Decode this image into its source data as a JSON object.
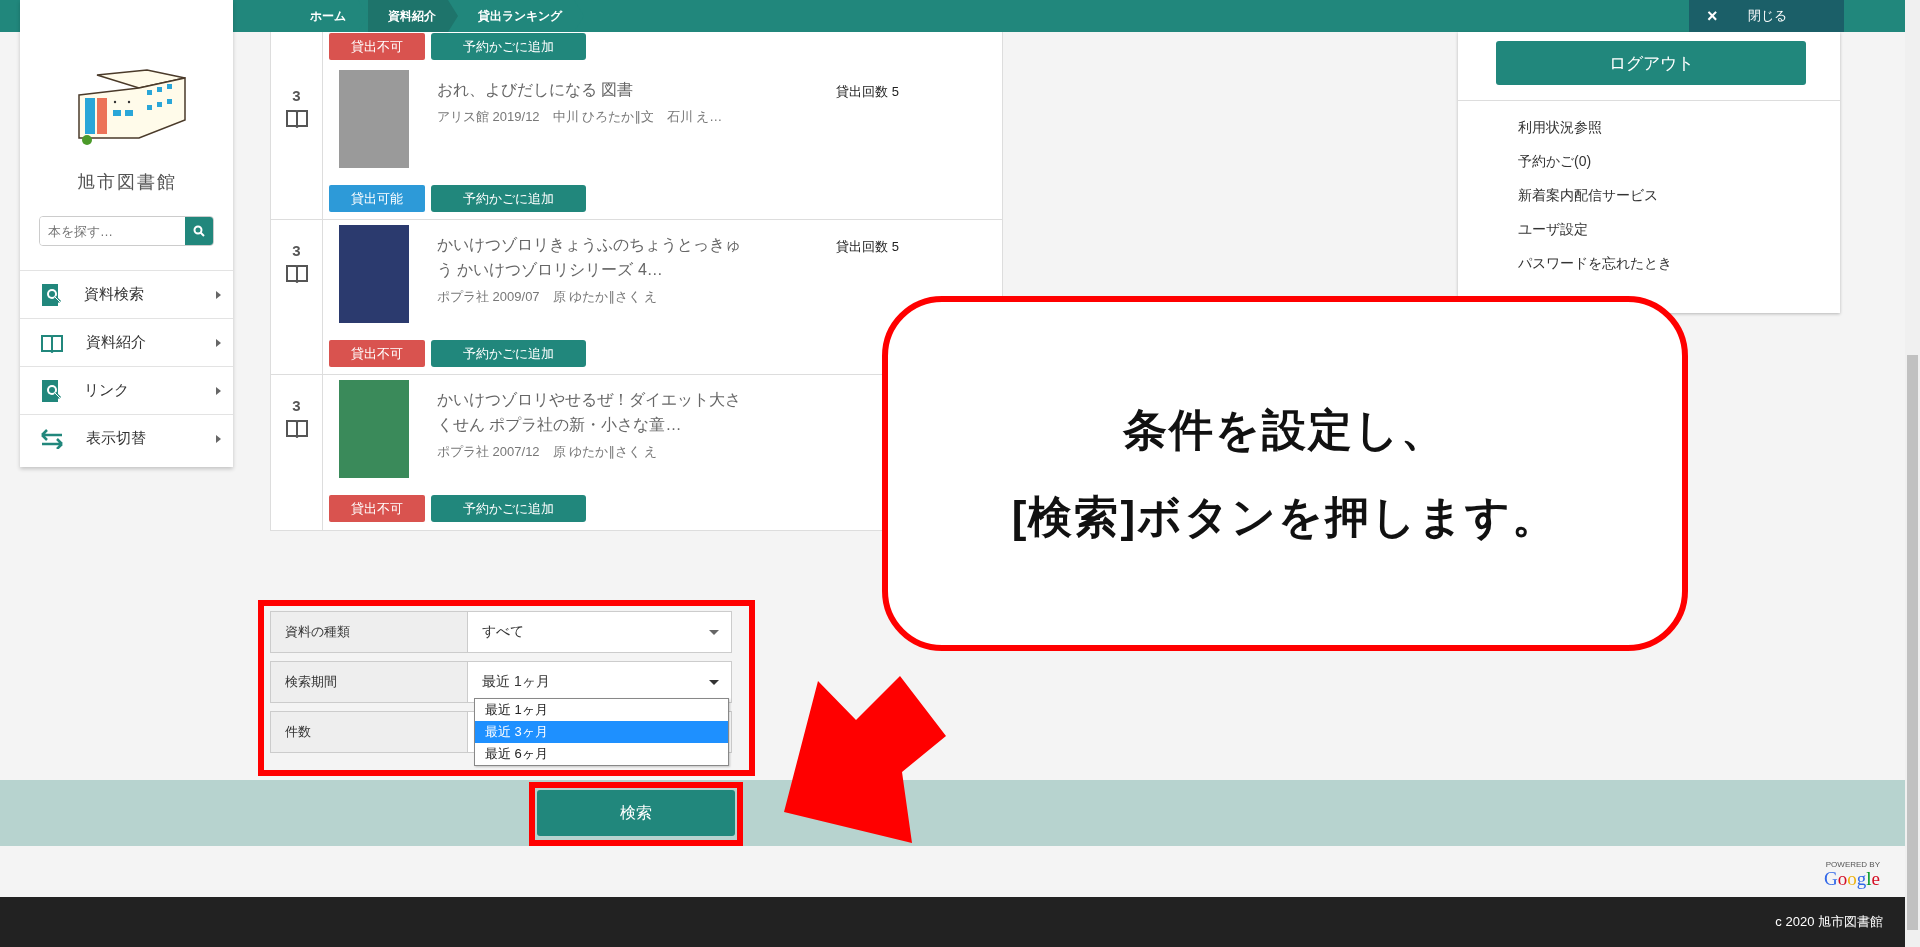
{
  "header": {
    "breadcrumbs": [
      {
        "label": "ホーム",
        "selected": false
      },
      {
        "label": "資料紹介",
        "selected": true
      },
      {
        "label": "貸出ランキング",
        "selected": false
      }
    ],
    "close_button": {
      "icon": "×",
      "label": "閉じる"
    }
  },
  "sidebar": {
    "library_name": "旭市図書館",
    "search": {
      "placeholder": "本を探す…"
    },
    "items": [
      {
        "label": "資料検索",
        "kind": "search"
      },
      {
        "label": "資料紹介",
        "kind": "book"
      },
      {
        "label": "リンク",
        "kind": "search"
      },
      {
        "label": "表示切替",
        "kind": "swap"
      }
    ]
  },
  "ranking": {
    "partial_row": {
      "status": {
        "label": "貸出不可",
        "available": false
      },
      "add_button": "予約かごに追加"
    },
    "rows": [
      {
        "rank": "3",
        "title": "おれ、よびだしになる 図書",
        "meta": "アリス館 2019/12　中川 ひろたか∥文　石川 え…",
        "loans": "貸出回数 5",
        "status": {
          "label": "貸出可能",
          "available": true
        },
        "add_button": "予約かごに追加"
      },
      {
        "rank": "3",
        "title": "かいけつゾロリきょうふのちょうとっきゅう かいけつゾロリシリーズ 4…",
        "meta": "ポプラ社 2009/07　原 ゆたか∥さく え",
        "loans": "貸出回数 5",
        "status": {
          "label": "貸出不可",
          "available": false
        },
        "add_button": "予約かごに追加"
      },
      {
        "rank": "3",
        "title": "かいけつゾロリやせるぜ！ダイエット大さくせん ポプラ社の新・小さな童…",
        "meta": "ポプラ社 2007/12　原 ゆたか∥さく え",
        "status": {
          "label": "貸出不可",
          "available": false
        },
        "add_button": "予約かごに追加"
      }
    ]
  },
  "user_menu": {
    "logout_button": "ログアウト",
    "links": [
      "利用状況参照",
      "予約かご(0)",
      "新着案内配信サービス",
      "ユーザ設定",
      "パスワードを忘れたとき"
    ]
  },
  "form": {
    "fields": [
      {
        "label": "資料の種類",
        "value": "すべて",
        "expanded": false
      },
      {
        "label": "検索期間",
        "value": "最近 1ヶ月",
        "expanded": true
      },
      {
        "label": "件数",
        "expanded": false
      }
    ],
    "dropdown_options": [
      {
        "label": "最近 1ヶ月",
        "selected": false
      },
      {
        "label": "最近 3ヶ月",
        "selected": true
      },
      {
        "label": "最近 6ヶ月",
        "selected": false
      }
    ],
    "search_button": "検索"
  },
  "powered_by": {
    "caption": "POWERED BY",
    "logo": "Google"
  },
  "footer": {
    "copyright": "c 2020 旭市図書館"
  },
  "annotation": {
    "lines": [
      "条件を設定し、",
      "[検索]ボタンを押します。"
    ]
  }
}
